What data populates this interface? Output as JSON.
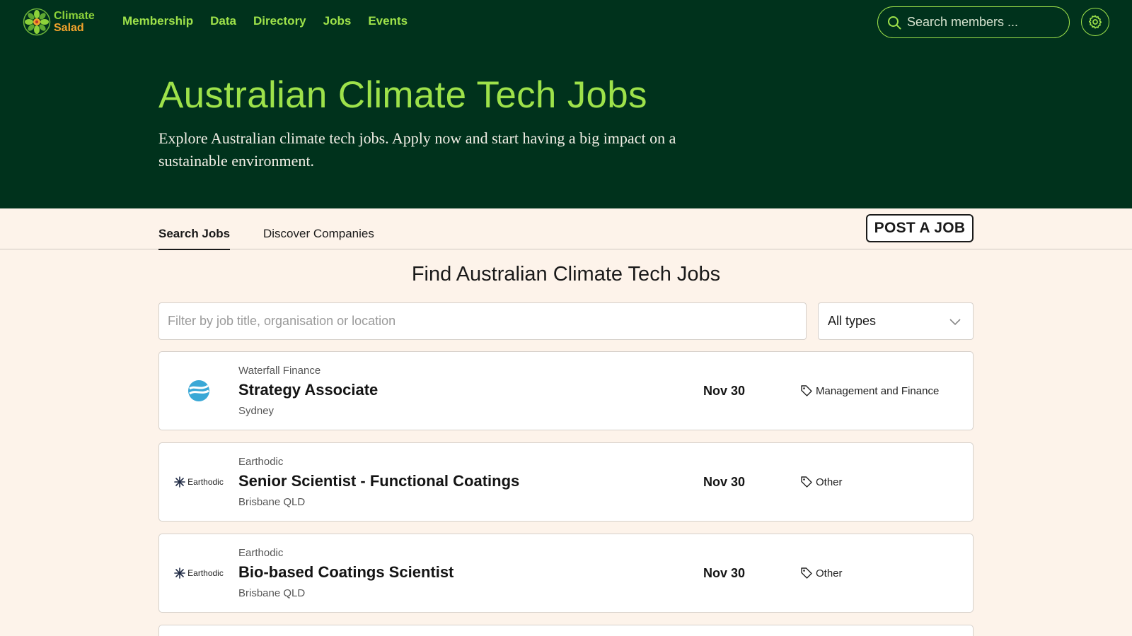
{
  "brand": {
    "name_line1": "Climate",
    "name_line2": "Salad"
  },
  "nav": {
    "items": [
      "Membership",
      "Data",
      "Directory",
      "Jobs",
      "Events"
    ]
  },
  "search": {
    "placeholder": "Search members ..."
  },
  "hero": {
    "title": "Australian Climate Tech Jobs",
    "description": "Explore Australian climate tech jobs. Apply now and start having a big impact on a sustainable environment."
  },
  "tabs": {
    "active": "Search Jobs",
    "other": "Discover Companies"
  },
  "post_job_label": "POST A JOB",
  "section_title": "Find Australian Climate Tech Jobs",
  "filter": {
    "placeholder": "Filter by job title, organisation or location",
    "type_value": "All types"
  },
  "jobs": [
    {
      "company": "Waterfall Finance",
      "title": "Strategy Associate",
      "location": "Sydney",
      "date": "Nov 30",
      "category": "Management and Finance",
      "logo_icon": "waterfall-logo-icon"
    },
    {
      "company": "Earthodic",
      "title": "Senior Scientist - Functional Coatings",
      "location": "Brisbane QLD",
      "date": "Nov 30",
      "category": "Other",
      "logo_text": "Earthodic",
      "logo_icon": "earthodic-logo-icon"
    },
    {
      "company": "Earthodic",
      "title": "Bio-based Coatings Scientist",
      "location": "Brisbane QLD",
      "date": "Nov 30",
      "category": "Other",
      "logo_text": "Earthodic",
      "logo_icon": "earthodic-logo-icon"
    }
  ],
  "colors": {
    "header_bg": "#00321c",
    "accent_green": "#9ee24a",
    "accent_orange": "#f2a32c",
    "page_bg": "#fdf3ea"
  }
}
